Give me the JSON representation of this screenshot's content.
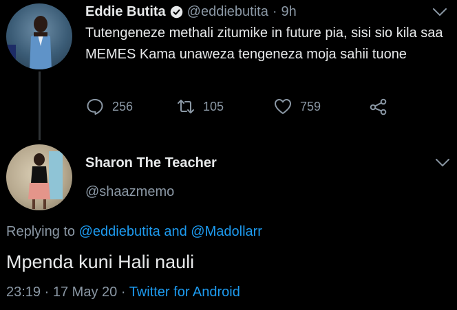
{
  "tweet": {
    "author_name": "Eddie Butita",
    "handle": "@eddiebutita",
    "separator": "·",
    "time_ago": "9h",
    "text": "Tutengeneze methali zitumike in future pia, sisi sio kila saa MEMES Kama unaweza tengeneza moja sahii tuone",
    "replies": "256",
    "retweets": "105",
    "likes": "759",
    "verified_icon": "verified-badge-icon",
    "menu_icon": "chevron-down-icon"
  },
  "reply": {
    "author_name": "Sharon The Teacher",
    "handle": "@shaazmemo",
    "replying_prefix": "Replying to",
    "replying_user_1": "@eddiebutita",
    "replying_and": "and",
    "replying_user_2": "@Madollarr",
    "text": "Mpenda kuni Hali nauli",
    "time": "23:19",
    "separator": "·",
    "date": "17 May 20",
    "separator2": "·",
    "source": "Twitter for Android"
  },
  "colors": {
    "background": "#000000",
    "primary_text": "#e7e9ea",
    "secondary_text": "#8b98a5",
    "link": "#1d9bf0",
    "thread_line": "#2f3336"
  }
}
